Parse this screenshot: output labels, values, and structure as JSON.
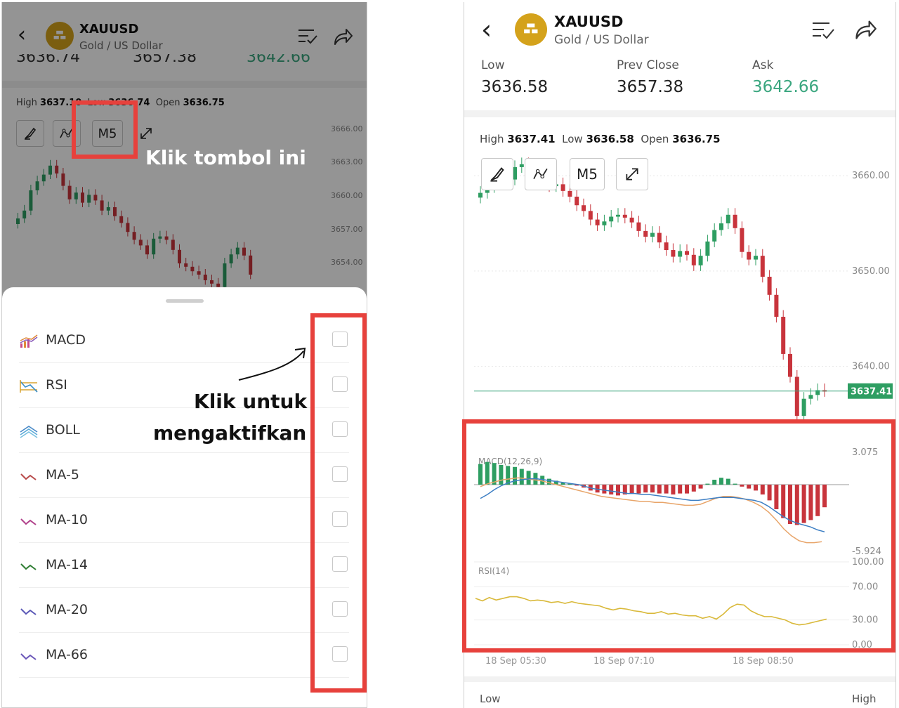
{
  "symbol": {
    "code": "XAUUSD",
    "name": "Gold / US Dollar"
  },
  "left_panel": {
    "cutoff_values": [
      "3636.74",
      "3657.38",
      "3642.66"
    ],
    "ohl": {
      "high_label": "High",
      "high_value": "3637.10",
      "low_label": "Low",
      "low_value": "3636.74",
      "open_label": "Open",
      "open_value": "3636.75"
    },
    "timeframe_label": "M5",
    "price_ticks": [
      "3666.00",
      "3663.00",
      "3660.00",
      "3657.00",
      "3654.00"
    ],
    "indicators": [
      {
        "label": "MACD",
        "icon": "macd-icon",
        "checked": false
      },
      {
        "label": "RSI",
        "icon": "rsi-icon",
        "checked": false
      },
      {
        "label": "BOLL",
        "icon": "boll-icon",
        "checked": false
      },
      {
        "label": "MA-5",
        "icon": "ma-icon",
        "color": "#b84a4a",
        "checked": false
      },
      {
        "label": "MA-10",
        "icon": "ma-icon",
        "color": "#b0408a",
        "checked": false
      },
      {
        "label": "MA-14",
        "icon": "ma-icon",
        "color": "#2e7d32",
        "checked": false
      },
      {
        "label": "MA-20",
        "icon": "ma-icon",
        "color": "#5a58b6",
        "checked": false
      },
      {
        "label": "MA-66",
        "icon": "ma-icon",
        "color": "#6a56b8",
        "checked": false
      }
    ]
  },
  "annotations": {
    "click_button": "Klik tombol ini",
    "click_enable_line1": "Klik untuk",
    "click_enable_line2": "mengaktifkan"
  },
  "right_panel": {
    "stats": [
      {
        "label": "Low",
        "value": "3636.58"
      },
      {
        "label": "Prev Close",
        "value": "3657.38"
      },
      {
        "label": "Ask",
        "value": "3642.66",
        "color": "#3aa67f"
      }
    ],
    "ohl": {
      "high_label": "High",
      "high_value": "3637.41",
      "low_label": "Low",
      "low_value": "3636.58",
      "open_label": "Open",
      "open_value": "3636.75"
    },
    "timeframe_label": "M5",
    "price_ticks": [
      "3660.00",
      "3650.00",
      "3640.00"
    ],
    "current_price": "3637.41",
    "macd_label": "MACD(12,26,9)",
    "macd_ticks": [
      "3.075",
      "-5.924"
    ],
    "rsi_label": "RSI(14)",
    "rsi_ticks": [
      "100.00",
      "70.00",
      "30.00",
      "0.00"
    ],
    "time_labels": [
      "18 Sep 05:30",
      "18 Sep 07:10",
      "18 Sep 08:50"
    ],
    "bottom_labels": [
      "Low",
      "High"
    ]
  },
  "colors": {
    "up": "#2e9e62",
    "down": "#c8343c",
    "highlight": "#e7413c",
    "gold": "#d4a21b",
    "rsi_line": "#d9b93a",
    "macd_dif": "#3d7fc4",
    "macd_dea": "#e8a56a"
  }
}
